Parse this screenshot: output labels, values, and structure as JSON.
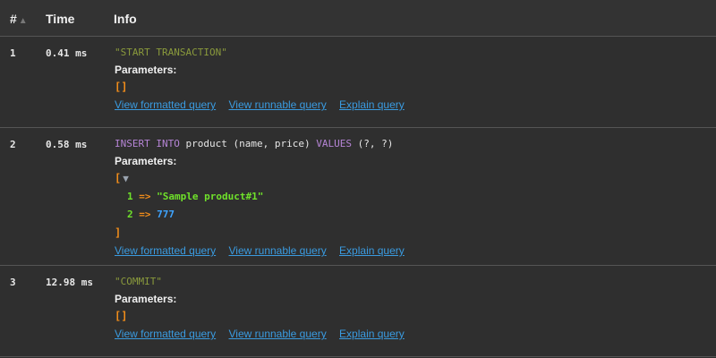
{
  "header": {
    "num": "#",
    "time": "Time",
    "info": "Info",
    "sort_icon": "sort-arrow-icon"
  },
  "rows": [
    {
      "num": "1",
      "time": "0.41 ms",
      "sql": "\"START TRANSACTION\"",
      "params_label": "Parameters:",
      "params_open": "[]",
      "links": [
        "View formatted query",
        "View runnable query",
        "Explain query"
      ]
    },
    {
      "num": "2",
      "time": "0.58 ms",
      "sql_parts": {
        "kw1": "INSERT",
        "kw2": "INTO",
        "mid": " product (name, price) ",
        "kw3": "VALUES",
        "end": " (?, ?)"
      },
      "params_label": "Parameters:",
      "params_open": "[",
      "params_close": "]",
      "items": [
        {
          "key": "1",
          "arrow": "=>",
          "value": "\"Sample product#1\""
        },
        {
          "key": "2",
          "arrow": "=>",
          "value": "777"
        }
      ],
      "links": [
        "View formatted query",
        "View runnable query",
        "Explain query"
      ]
    },
    {
      "num": "3",
      "time": "12.98 ms",
      "sql": "\"COMMIT\"",
      "params_label": "Parameters:",
      "params_open": "[]",
      "links": [
        "View formatted query",
        "View runnable query",
        "Explain query"
      ]
    }
  ],
  "colors": {
    "background": "#2f2f2f",
    "link": "#3a9be0",
    "keyword": "#b685d6",
    "string": "#8a9a3c",
    "bracket": "#f08c1a",
    "param_key": "#6fe12a",
    "number": "#3ea4ff"
  }
}
